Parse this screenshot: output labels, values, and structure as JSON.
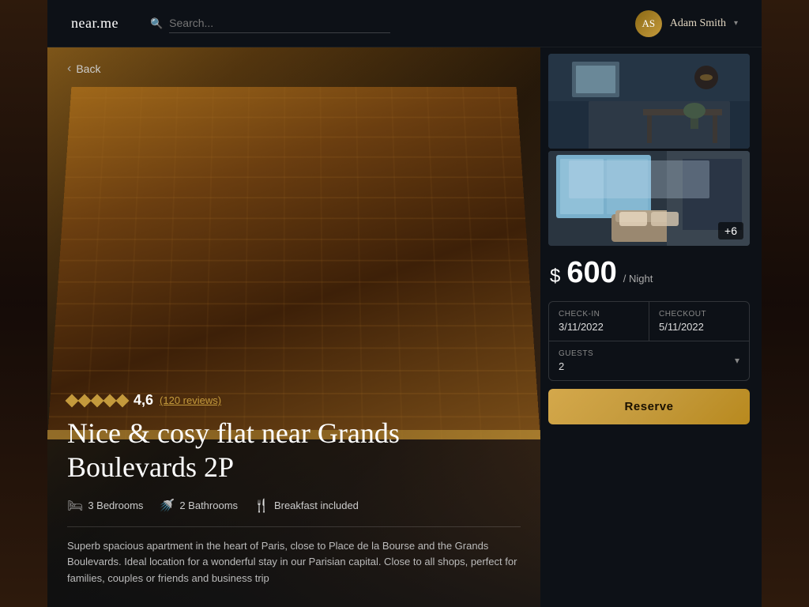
{
  "header": {
    "logo": "near.me",
    "search_placeholder": "Search...",
    "user_name": "Adam Smith"
  },
  "nav": {
    "back_label": "Back"
  },
  "property": {
    "rating": "4,6",
    "reviews": "(120 reviews)",
    "title": "Nice & cosy flat near Grands Boulevards 2P",
    "amenities": [
      {
        "icon": "🛏",
        "label": "3 Bedrooms"
      },
      {
        "icon": "🚿",
        "label": "2 Bathrooms"
      },
      {
        "icon": "🍴",
        "label": "Breakfast included"
      }
    ],
    "description": "Superb spacious apartment in the heart of Paris, close to Place de la Bourse and the\nGrands Boulevards. Ideal location for a wonderful stay in our Parisian capital.\nClose to all shops, perfect for families, couples or friends and business trip"
  },
  "gallery": {
    "more_count": "+6"
  },
  "booking": {
    "price_symbol": "$",
    "price_amount": "600",
    "per_night_label": "/ Night",
    "checkin_label": "Check-in",
    "checkin_value": "3/11/2022",
    "checkout_label": "Checkout",
    "checkout_value": "5/11/2022",
    "guests_label": "Guests",
    "guests_value": "2",
    "reserve_label": "Reserve"
  }
}
